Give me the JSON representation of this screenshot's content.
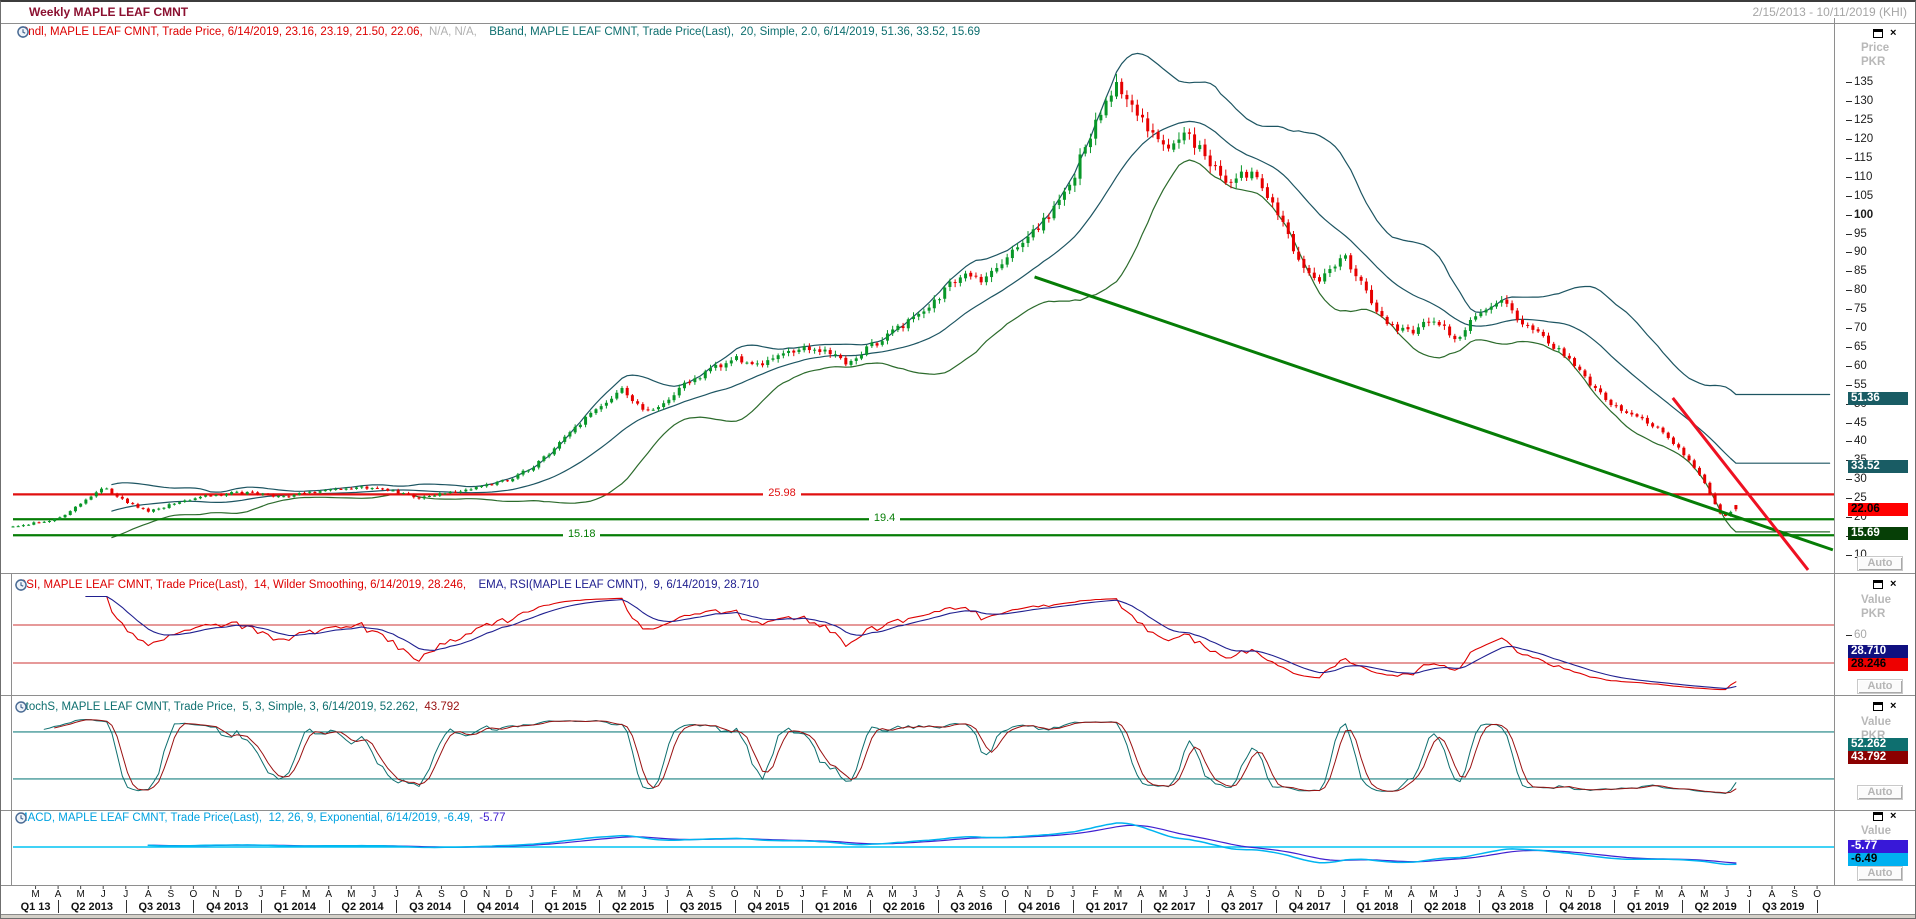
{
  "window": {
    "title": "Weekly MAPLE LEAF CMNT",
    "date_range": "2/15/2013 - 10/11/2019 (KHI)",
    "auto_label": "Auto",
    "close_icon": "×"
  },
  "axis": {
    "price_title": "Price",
    "value_title": "Value",
    "unit": "PKR"
  },
  "legends": {
    "price": [
      {
        "icon": true
      },
      {
        "text": "Cndl, MAPLE LEAF CMNT, Trade Price, 6/14/2019, 23.16, 23.19, 21.50, 22.06, ",
        "color": "#dd0000"
      },
      {
        "text": "N/A, N/A,  ",
        "color": "#b0b0b0"
      },
      {
        "icon": true
      },
      {
        "text": "BBand, MAPLE LEAF CMNT, Trade Price(Last),  20, Simple, 2.0, 6/14/2019, 51.36, 33.52, 15.69",
        "color": "#0e6f6f"
      }
    ],
    "rsi": [
      {
        "icon": true
      },
      {
        "text": "RSI, MAPLE LEAF CMNT, Trade Price(Last),  14, Wilder Smoothing, 6/14/2019, 28.246,  ",
        "color": "#dd0000"
      },
      {
        "icon": true
      },
      {
        "text": "EMA, RSI(MAPLE LEAF CMNT),  9, 6/14/2019, 28.710",
        "color": "#202090"
      }
    ],
    "stoch": [
      {
        "icon": true
      },
      {
        "text": "StochS, MAPLE LEAF CMNT, Trade Price,  5, 3, Simple, 3, 6/14/2019, 52.262, ",
        "color": "#0e6f6f"
      },
      {
        "text": "43.792",
        "color": "#991111"
      }
    ],
    "macd": [
      {
        "icon": true
      },
      {
        "text": "MACD, MAPLE LEAF CMNT, Trade Price(Last),  12, 26, 9, Exponential, 6/14/2019, -6.49, ",
        "color": "#00a2e0"
      },
      {
        "text": "-5.77",
        "color": "#4020d0"
      }
    ]
  },
  "price_panel": {
    "ticks": [
      135,
      130,
      125,
      120,
      115,
      110,
      105,
      100,
      95,
      90,
      85,
      80,
      75,
      70,
      65,
      60,
      55,
      50,
      45,
      40,
      35,
      30,
      25,
      20,
      15,
      10
    ],
    "bold_tick": 100,
    "badges": [
      {
        "label": "51.36",
        "value": 51.36,
        "bg": "#195c64",
        "fg": "#ffffff"
      },
      {
        "label": "33.52",
        "value": 33.52,
        "bg": "#195c64",
        "fg": "#ffffff"
      },
      {
        "label": "22.06",
        "value": 22.06,
        "bg": "#ff0000",
        "fg": "#000000"
      },
      {
        "label": "15.69",
        "value": 15.69,
        "bg": "#063f06",
        "fg": "#ffffff"
      }
    ],
    "hlines": [
      {
        "label": "25.98",
        "value": 25.98,
        "color": "#e01010",
        "label_frac": 0.412
      },
      {
        "label": "19.4",
        "value": 19.4,
        "color": "#067d06",
        "label_frac": 0.47
      },
      {
        "label": "15.18",
        "value": 15.18,
        "color": "#067d06",
        "label_frac": 0.302
      }
    ]
  },
  "rsi_panel": {
    "ticks": [
      60
    ],
    "bands": [
      70,
      30
    ],
    "badges": [
      {
        "label": "28.710",
        "value": 28.71,
        "bg": "#101080",
        "fg": "#ffffff"
      },
      {
        "label": "28.246",
        "value": 28.246,
        "bg": "#ee0000",
        "fg": "#000000"
      }
    ]
  },
  "stoch_panel": {
    "bands": [
      80,
      20
    ],
    "badges": [
      {
        "label": "52.262",
        "value": 52.262,
        "bg": "#0e6f6f",
        "fg": "#ffffff"
      },
      {
        "label": "43.792",
        "value": 43.792,
        "bg": "#8b0000",
        "fg": "#ffffff"
      }
    ]
  },
  "macd_panel": {
    "badges": [
      {
        "label": "-5.77",
        "value": -5.77,
        "bg": "#3818d8",
        "fg": "#ffffff"
      },
      {
        "label": "-6.49",
        "value": -6.49,
        "bg": "#00b0f0",
        "fg": "#000000"
      }
    ]
  },
  "xaxis": {
    "months": [
      "M",
      "A",
      "M",
      "J",
      "J",
      "A",
      "S",
      "O",
      "N",
      "D",
      "J",
      "F",
      "M",
      "A",
      "M",
      "J",
      "J",
      "A",
      "S",
      "O",
      "N",
      "D",
      "J",
      "F",
      "M",
      "A",
      "M",
      "J",
      "J",
      "A",
      "S",
      "O",
      "N",
      "D",
      "J",
      "F",
      "M",
      "A",
      "M",
      "J",
      "J",
      "A",
      "S",
      "O",
      "N",
      "D",
      "J",
      "F",
      "M",
      "A",
      "M",
      "J",
      "J",
      "A",
      "S",
      "O",
      "N",
      "D",
      "J",
      "F",
      "M",
      "A",
      "M",
      "J",
      "J",
      "A",
      "S",
      "O",
      "N",
      "D",
      "J",
      "F",
      "M",
      "A",
      "M",
      "J",
      "J",
      "A",
      "S",
      "O"
    ],
    "quarters": [
      "Q1 13",
      "Q2 2013",
      "Q3 2013",
      "Q4 2013",
      "Q1 2014",
      "Q2 2014",
      "Q3 2014",
      "Q4 2014",
      "Q1 2015",
      "Q2 2015",
      "Q3 2015",
      "Q4 2015",
      "Q1 2016",
      "Q2 2016",
      "Q3 2016",
      "Q4 2016",
      "Q1 2017",
      "Q2 2017",
      "Q3 2017",
      "Q4 2017",
      "Q1 2018",
      "Q2 2018",
      "Q3 2018",
      "Q4 2018",
      "Q1 2019",
      "Q2 2019",
      "Q3 2019"
    ]
  },
  "chart_data": {
    "type": "candlestick",
    "symbol": "MAPLE LEAF CMNT",
    "interval": "weekly",
    "x_range": [
      "2/15/2013",
      "10/11/2019"
    ],
    "price_axis": {
      "unit": "PKR",
      "tick_step": 5,
      "min_tick": 10,
      "max_tick": 135
    },
    "last_bar": {
      "date": "6/14/2019",
      "open": 23.16,
      "high": 23.19,
      "low": 21.5,
      "close": 22.06
    },
    "bollinger": {
      "period": 20,
      "ma_type": "Simple",
      "width": 2.0,
      "upper": 51.36,
      "middle": 33.52,
      "lower": 15.69
    },
    "rsi": {
      "period": 14,
      "smoothing": "Wilder Smoothing",
      "value": 28.246,
      "ema_period": 9,
      "ema_value": 28.71,
      "guide_lines": [
        70,
        30
      ]
    },
    "stochastic": {
      "params": [
        5,
        3,
        3
      ],
      "ma_type": "Simple",
      "k": 52.262,
      "d": 43.792,
      "guide_lines": [
        80,
        20
      ]
    },
    "macd": {
      "params": [
        12,
        26,
        9
      ],
      "ma_type": "Exponential",
      "macd": -6.49,
      "signal": -5.77
    },
    "support_resistance_levels": [
      25.98,
      19.4,
      15.18
    ],
    "trendlines": [
      {
        "from_month": 45.3,
        "from_price": 83.5,
        "to_month": 80.7,
        "to_price": 11.3,
        "color": "#067d06",
        "width": 3
      },
      {
        "from_month": 73.6,
        "from_price": 51.5,
        "to_month": 79.6,
        "to_price": 6.0,
        "color": "#ee1122",
        "width": 3
      }
    ],
    "approx_monthly_close_path": [
      [
        0,
        17.5
      ],
      [
        2,
        19.5
      ],
      [
        4,
        28
      ],
      [
        5,
        24
      ],
      [
        6,
        21.5
      ],
      [
        8,
        25
      ],
      [
        10,
        26.5
      ],
      [
        12,
        25.5
      ],
      [
        14,
        27
      ],
      [
        16,
        28
      ],
      [
        18,
        25
      ],
      [
        20,
        27
      ],
      [
        22,
        30
      ],
      [
        23,
        33
      ],
      [
        24,
        38
      ],
      [
        25,
        44
      ],
      [
        26,
        49
      ],
      [
        27,
        54
      ],
      [
        28,
        47.5
      ],
      [
        29,
        51
      ],
      [
        30,
        56
      ],
      [
        31,
        59
      ],
      [
        32,
        62.5
      ],
      [
        33,
        60
      ],
      [
        34,
        63
      ],
      [
        35,
        65
      ],
      [
        36,
        63.5
      ],
      [
        37,
        61
      ],
      [
        38,
        65
      ],
      [
        39,
        69
      ],
      [
        40,
        73
      ],
      [
        41,
        78
      ],
      [
        42,
        84
      ],
      [
        43,
        82
      ],
      [
        44,
        88
      ],
      [
        45,
        94
      ],
      [
        46,
        100
      ],
      [
        47,
        110
      ],
      [
        48,
        124
      ],
      [
        49,
        134
      ],
      [
        50,
        126
      ],
      [
        51,
        117
      ],
      [
        52,
        122
      ],
      [
        53,
        115
      ],
      [
        54,
        108
      ],
      [
        55,
        112
      ],
      [
        56,
        102
      ],
      [
        57,
        88
      ],
      [
        58,
        82
      ],
      [
        59,
        90
      ],
      [
        60,
        79
      ],
      [
        61,
        71
      ],
      [
        62,
        69
      ],
      [
        63,
        72.5
      ],
      [
        64,
        67
      ],
      [
        65,
        74
      ],
      [
        66,
        77
      ],
      [
        67,
        71
      ],
      [
        68,
        67
      ],
      [
        69,
        62
      ],
      [
        70,
        55
      ],
      [
        71,
        49.5
      ],
      [
        72,
        47
      ],
      [
        73,
        43.5
      ],
      [
        74,
        37
      ],
      [
        74.8,
        31
      ],
      [
        75.4,
        24.5
      ],
      [
        75.8,
        19.8
      ],
      [
        76.4,
        22.06
      ]
    ],
    "colors": {
      "candle_up": "#089728",
      "candle_down": "#e60000",
      "bband_upper": "#1d5562",
      "bband_middle": "#1d5562",
      "bband_lower": "#2c6b2c",
      "rsi": "#dd0000",
      "rsi_ema": "#202090",
      "rsi_guide": "#cc3333",
      "stoch_k": "#0e6f6f",
      "stoch_d": "#991111",
      "stoch_guide": "#1a8080",
      "macd": "#00b4f0",
      "macd_signal": "#4020d0",
      "macd_zero": "#00c4f4"
    }
  }
}
